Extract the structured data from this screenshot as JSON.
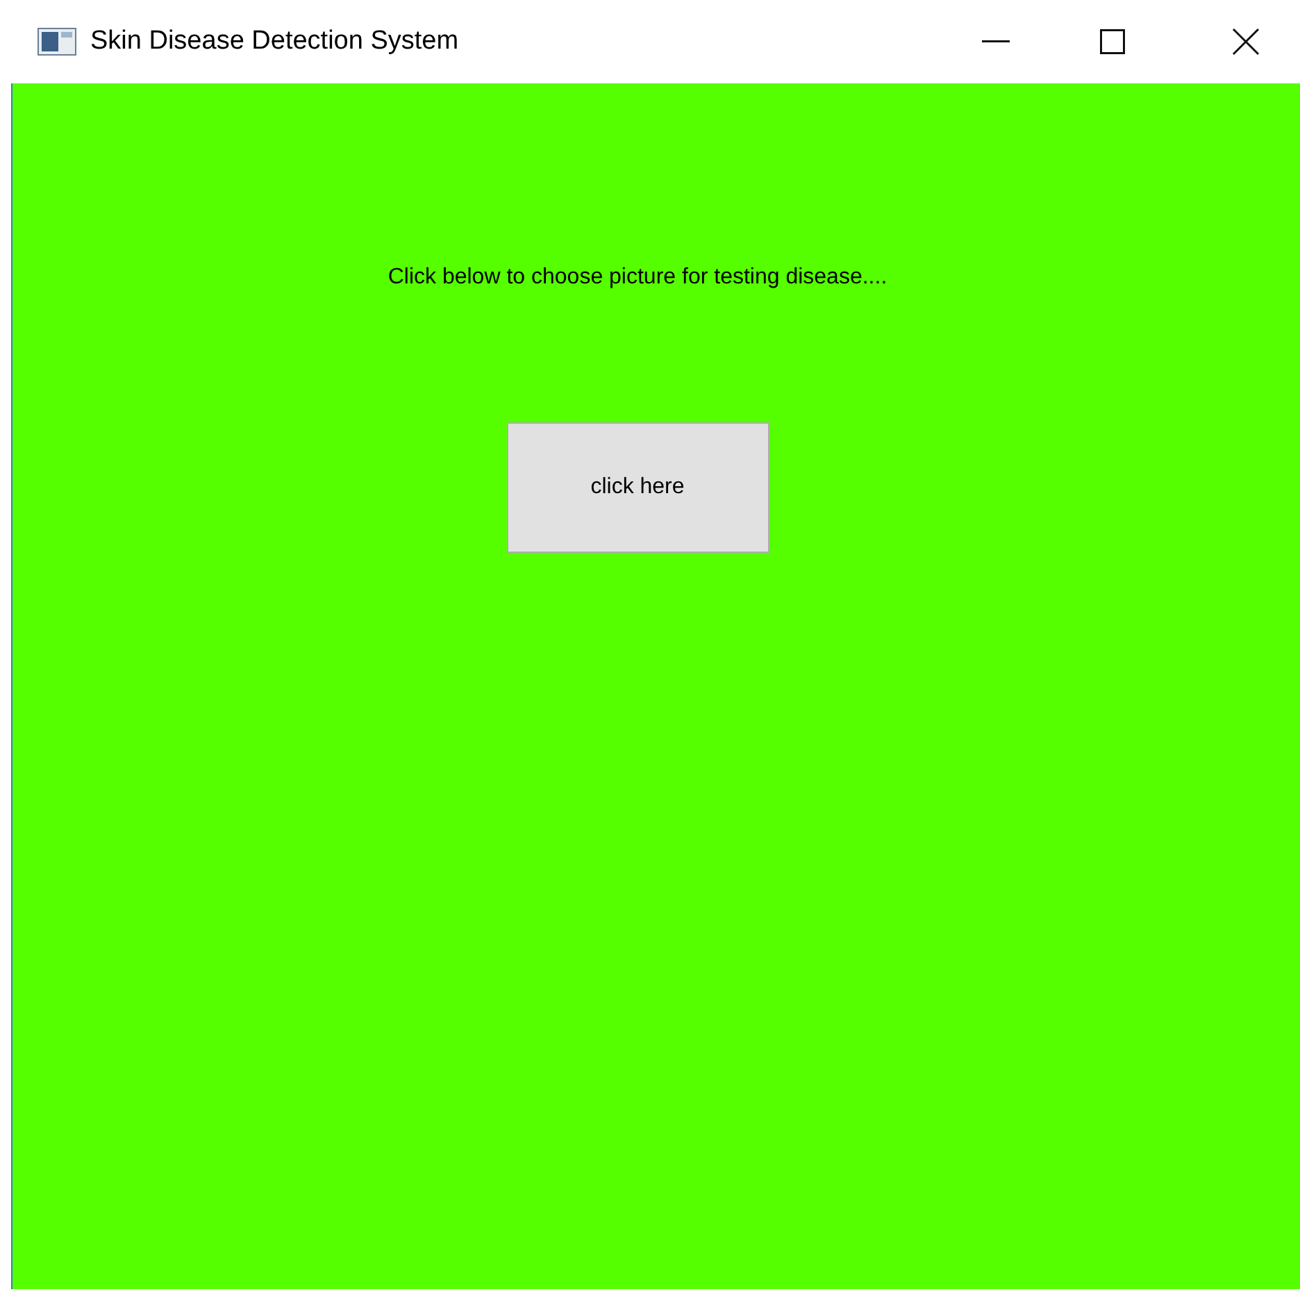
{
  "window": {
    "title": "Skin Disease Detection System"
  },
  "prompt": "Click below to choose picture for testing disease....",
  "button": {
    "label": "click here"
  }
}
